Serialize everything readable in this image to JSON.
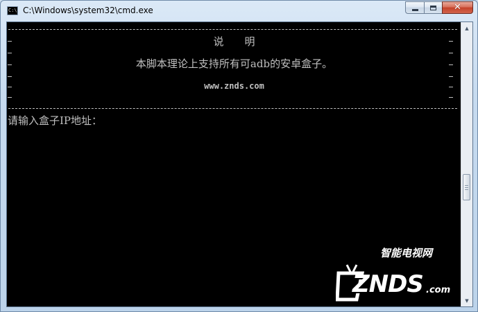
{
  "window": {
    "title": "C:\\Windows\\system32\\cmd.exe",
    "icon": "cmd-console-icon",
    "icon_text": "C:\\"
  },
  "caption_buttons": {
    "minimize_icon": "minimize-icon",
    "maximize_icon": "maximize-icon",
    "close_icon": "close-icon",
    "close_glyph": "✕"
  },
  "console": {
    "heading": "说明",
    "description": "本脚本理论上支持所有可adb的安卓盒子。",
    "website": "www.znds.com",
    "prompt": "请输入盒子IP地址：",
    "text_color": "#c0c0c0",
    "background": "#000000"
  },
  "scrollbar": {
    "up_icon": "scroll-up-arrow-icon",
    "down_icon": "scroll-down-arrow-icon",
    "up_glyph": "▲",
    "down_glyph": "▼"
  },
  "watermark": {
    "cn_text": "智能电视网",
    "logo_text": "ZNDS",
    "suffix": ".com"
  }
}
